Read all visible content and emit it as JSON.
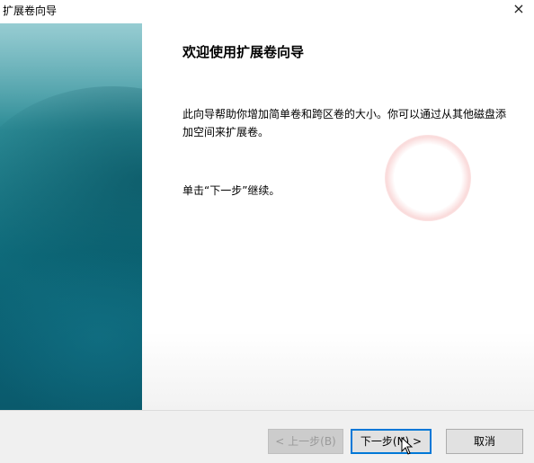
{
  "window": {
    "title": "扩展卷向导",
    "close_glyph": "×"
  },
  "content": {
    "heading": "欢迎使用扩展卷向导",
    "description": "此向导帮助你增加简单卷和跨区卷的大小。你可以通过从其他磁盘添加空间来扩展卷。",
    "instruction": "单击“下一步”继续。"
  },
  "buttons": {
    "back": "< 上一步(B)",
    "next": "下一步(N) >",
    "cancel": "取消"
  },
  "colors": {
    "accent": "#0078d7",
    "side_panel": "#0e6a7a"
  }
}
